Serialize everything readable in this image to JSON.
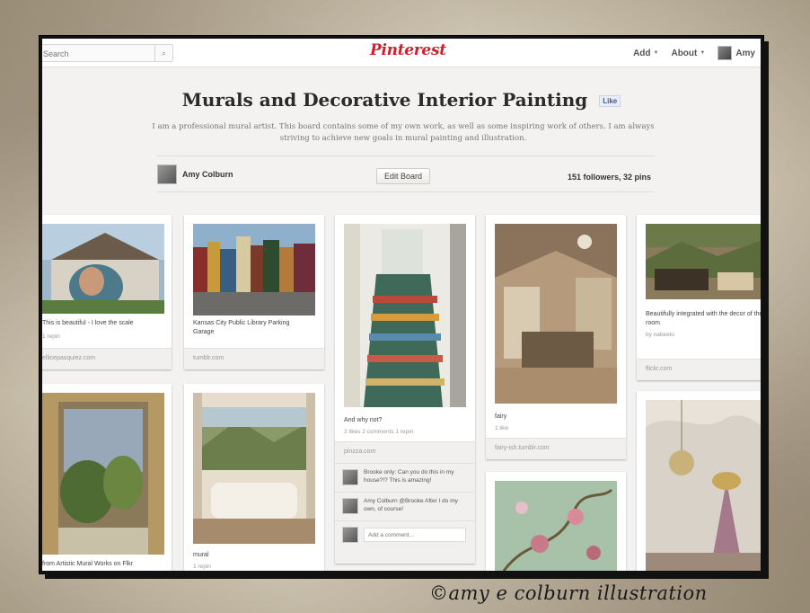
{
  "nav": {
    "search_placeholder": "Search",
    "search_icon": "magnifier-icon",
    "logo": "Pinterest",
    "add_label": "Add",
    "about_label": "About",
    "user_label": "Amy"
  },
  "board": {
    "title": "Murals and Decorative Interior Painting",
    "like_label": "Like",
    "description": "I am a professional mural artist. This board contains some of my own work, as well as some inspiring work of others. I am always striving to achieve new goals in mural painting and illustration.",
    "owner_name": "Amy Colburn",
    "edit_label": "Edit Board",
    "stats": "151 followers, 32 pins"
  },
  "pins": [
    {
      "desc": "This is beautiful - I love the scale",
      "meta": "1 repin",
      "source": "ellicepasquiez.com"
    },
    {
      "desc": "Kansas City Public Library Parking Garage",
      "meta": "",
      "source": "tumblr.com"
    },
    {
      "desc": "And why not?",
      "meta": "2 likes   2 comments   1 repin",
      "source": "pinzza.com"
    },
    {
      "desc": "fairy",
      "meta": "1 like",
      "source": "fairy-ish.tumblr.com"
    },
    {
      "desc": "Beautifully integrated with the decor of the room",
      "meta": "by nabeelo",
      "source": "flickr.com"
    },
    {
      "desc": "from Artistic Mural Works on Flkr",
      "meta": "",
      "source": ""
    },
    {
      "desc": "mural",
      "meta": "1 repin",
      "source": ""
    }
  ],
  "comments": [
    {
      "text": "Brooke only: Can you do this in my house?!? This is amazing!"
    },
    {
      "text": "Amy Colburn @Brooke After I do my own, of course!"
    }
  ],
  "comment_placeholder": "Add a comment...",
  "watermark": "©amy e colburn illustration"
}
